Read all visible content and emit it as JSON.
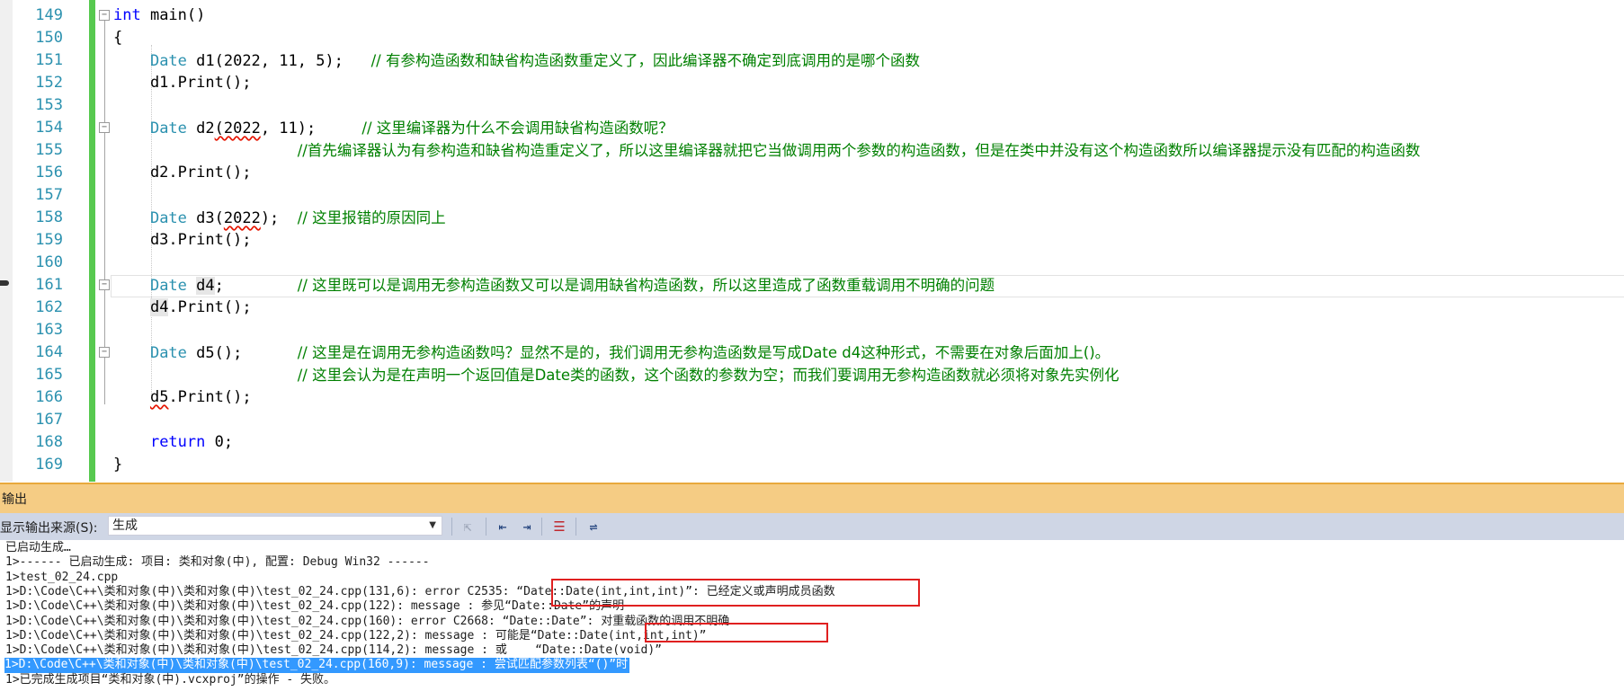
{
  "editor": {
    "lines": [
      {
        "n": "149",
        "parts": [
          {
            "t": "int",
            "c": "kw"
          },
          {
            "t": " main()",
            "c": "nm"
          }
        ]
      },
      {
        "n": "150",
        "parts": [
          {
            "t": "{",
            "c": "nm"
          }
        ]
      },
      {
        "n": "151",
        "parts": [
          {
            "t": "    "
          },
          {
            "t": "Date",
            "c": "ty"
          },
          {
            "t": " d1(2022, 11, 5);   ",
            "c": "nm"
          },
          {
            "t": "// 有参构造函数和缺省构造函数重定义了，因此编译器不确定到底调用的是哪个函数",
            "c": "cm"
          }
        ]
      },
      {
        "n": "152",
        "parts": [
          {
            "t": "    d1.Print();",
            "c": "nm"
          }
        ]
      },
      {
        "n": "153",
        "parts": []
      },
      {
        "n": "154",
        "parts": [
          {
            "t": "    "
          },
          {
            "t": "Date",
            "c": "ty"
          },
          {
            "t": " d2",
            "c": "nm"
          },
          {
            "t": "(2022",
            "c": "nm sq"
          },
          {
            "t": ", 11);     ",
            "c": "nm"
          },
          {
            "t": "// 这里编译器为什么不会调用缺省构造函数呢？",
            "c": "cm"
          }
        ]
      },
      {
        "n": "155",
        "parts": [
          {
            "t": "                    "
          },
          {
            "t": "//首先编译器认为有参构造和缺省构造重定义了，所以这里编译器就把它当做调用两个参数的构造函数，但是在类中并没有这个构造函数所以编译器提示没有匹配的构造函数",
            "c": "cm"
          }
        ]
      },
      {
        "n": "156",
        "parts": [
          {
            "t": "    d2.Print();",
            "c": "nm"
          }
        ]
      },
      {
        "n": "157",
        "parts": []
      },
      {
        "n": "158",
        "parts": [
          {
            "t": "    "
          },
          {
            "t": "Date",
            "c": "ty"
          },
          {
            "t": " d3(",
            "c": "nm"
          },
          {
            "t": "2022",
            "c": "nm sq"
          },
          {
            "t": ");  ",
            "c": "nm"
          },
          {
            "t": "// 这里报错的原因同上",
            "c": "cm"
          }
        ]
      },
      {
        "n": "159",
        "parts": [
          {
            "t": "    d3.Print();",
            "c": "nm"
          }
        ]
      },
      {
        "n": "160",
        "parts": []
      },
      {
        "n": "161",
        "parts": [
          {
            "t": "    "
          },
          {
            "t": "Date",
            "c": "ty"
          },
          {
            "t": " ",
            "c": "nm"
          },
          {
            "t": "d4",
            "c": "nm hl"
          },
          {
            "t": ";        ",
            "c": "nm"
          },
          {
            "t": "// 这里既可以是调用无参构造函数又可以是调用缺省构造函数，所以这里造成了函数重载调用不明确的问题",
            "c": "cm"
          }
        ]
      },
      {
        "n": "162",
        "parts": [
          {
            "t": "    "
          },
          {
            "t": "d4",
            "c": "nm hl"
          },
          {
            "t": ".Print();",
            "c": "nm"
          }
        ]
      },
      {
        "n": "163",
        "parts": []
      },
      {
        "n": "164",
        "parts": [
          {
            "t": "    "
          },
          {
            "t": "Date",
            "c": "ty"
          },
          {
            "t": " d5();      ",
            "c": "nm"
          },
          {
            "t": "// 这里是在调用无参构造函数吗？显然不是的，我们调用无参构造函数是写成Date d4这种形式，不需要在对象后面加上()。",
            "c": "cm"
          }
        ]
      },
      {
        "n": "165",
        "parts": [
          {
            "t": "                    "
          },
          {
            "t": "// 这里会认为是在声明一个返回值是Date类的函数，这个函数的参数为空；而我们要调用无参构造函数就必须将对象先实例化",
            "c": "cm"
          }
        ]
      },
      {
        "n": "166",
        "parts": [
          {
            "t": "    "
          },
          {
            "t": "d5",
            "c": "nm sq"
          },
          {
            "t": ".Print();",
            "c": "nm"
          }
        ]
      },
      {
        "n": "167",
        "parts": []
      },
      {
        "n": "168",
        "parts": [
          {
            "t": "    "
          },
          {
            "t": "return",
            "c": "kw"
          },
          {
            "t": " 0;",
            "c": "nm"
          }
        ]
      },
      {
        "n": "169",
        "parts": [
          {
            "t": "}",
            "c": "nm"
          }
        ]
      }
    ],
    "fold_lines": [
      "149",
      "154",
      "161",
      "164"
    ]
  },
  "output": {
    "title": "输出",
    "source_label": "显示输出来源(S):",
    "source_value": "生成",
    "lines": [
      "已启动生成…",
      "1>------ 已启动生成: 项目: 类和对象(中), 配置: Debug Win32 ------",
      "1>test_02_24.cpp",
      "1>D:\\Code\\C++\\类和对象(中)\\类和对象(中)\\test_02_24.cpp(131,6): error C2535: “Date::Date(int,int,int)”: 已经定义或声明成员函数",
      "1>D:\\Code\\C++\\类和对象(中)\\类和对象(中)\\test_02_24.cpp(122): message : 参见“Date::Date”的声明",
      "1>D:\\Code\\C++\\类和对象(中)\\类和对象(中)\\test_02_24.cpp(160): error C2668: “Date::Date”: 对重载函数的调用不明确",
      "1>D:\\Code\\C++\\类和对象(中)\\类和对象(中)\\test_02_24.cpp(122,2): message : 可能是“Date::Date(int,int,int)”",
      "1>D:\\Code\\C++\\类和对象(中)\\类和对象(中)\\test_02_24.cpp(114,2): message : 或    “Date::Date(void)”",
      "1>D:\\Code\\C++\\类和对象(中)\\类和对象(中)\\test_02_24.cpp(160,9): message : 尝试匹配参数列表“()”时",
      "1>已完成生成项目“类和对象(中).vcxproj”的操作 - 失败。"
    ],
    "selected_line": 8
  },
  "colors": {
    "comment": "#008000",
    "keyword": "#0000ff",
    "type": "#2b91af",
    "line_number": "#2b91af",
    "change_bar": "#57c94f",
    "panel_title": "#f5cc84",
    "selection": "#3399ff",
    "annotation_box": "#e02020"
  },
  "icons": [
    "find-message-icon",
    "prev-message-icon",
    "next-message-icon",
    "clear-all-icon",
    "word-wrap-icon"
  ]
}
